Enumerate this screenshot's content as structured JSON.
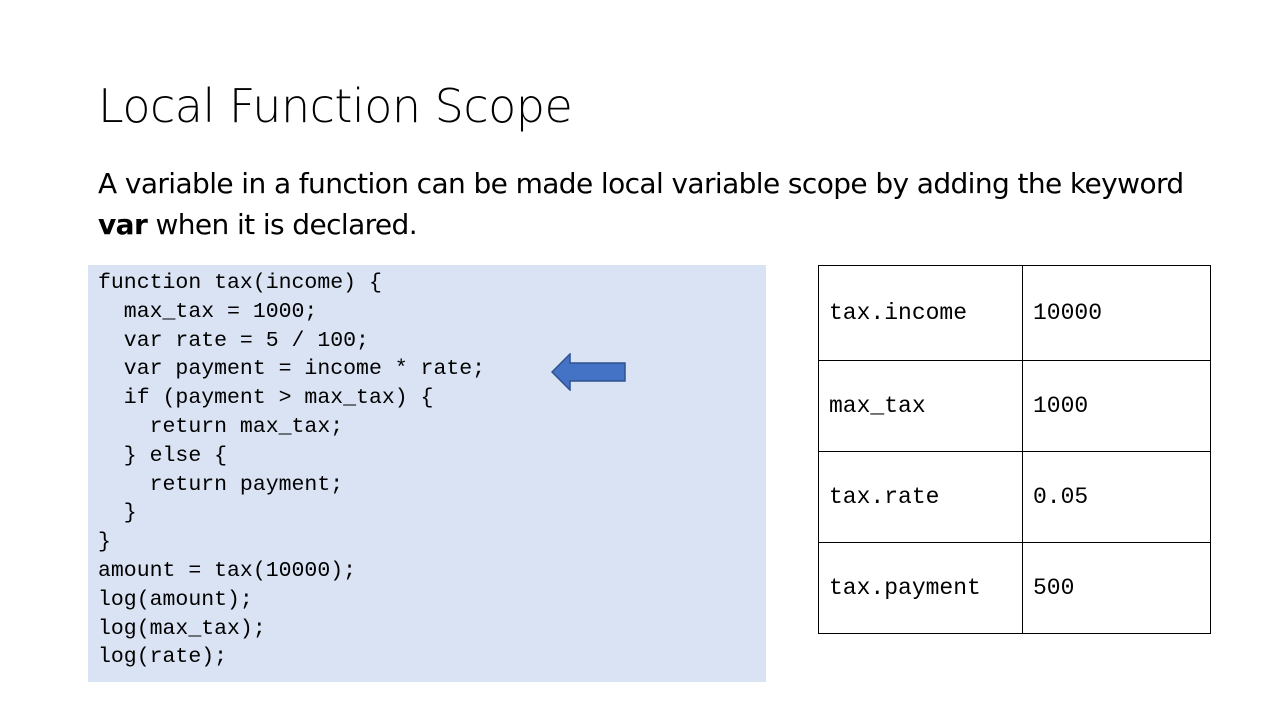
{
  "slide": {
    "title": "Local Function Scope",
    "body_before": "A variable in a function can be made local variable scope by adding the keyword ",
    "body_keyword": "var",
    "body_after": " when it is declared."
  },
  "code": {
    "lines": [
      "function tax(income) {",
      "  max_tax = 1000;",
      "  var rate = 5 / 100;",
      "  var payment = income * rate;",
      "  if (payment > max_tax) {",
      "    return max_tax;",
      "  } else {",
      "    return payment;",
      "  }",
      "}",
      "amount = tax(10000);",
      "log(amount);",
      "log(max_tax);",
      "log(rate);"
    ],
    "background": "#dae3f3"
  },
  "arrow": {
    "icon": "left-arrow-icon",
    "fill": "#4472c4",
    "stroke": "#2f528f"
  },
  "variables": [
    {
      "name": "tax.income",
      "value": "10000"
    },
    {
      "name": "max_tax",
      "value": "1000"
    },
    {
      "name": "tax.rate",
      "value": "0.05"
    },
    {
      "name": "tax.payment",
      "value": "500"
    }
  ]
}
